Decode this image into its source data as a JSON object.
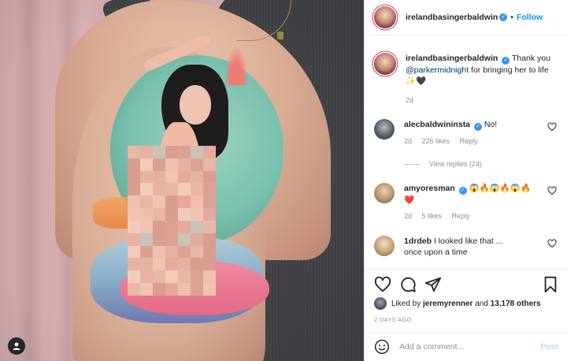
{
  "post": {
    "author": "irelandbasingerbaldwin",
    "follow_label": "Follow",
    "separator": "•"
  },
  "caption": {
    "author": "irelandbasingerbaldwin",
    "text_before": "Thank you",
    "mention": "@parkermidnight",
    "text_after": "for bringing her to life",
    "emoji": "✨🖤",
    "age": "2d"
  },
  "comments": [
    {
      "user": "alecbaldwininsta",
      "verified": true,
      "text": "No!",
      "age": "2d",
      "likes": "226 likes",
      "reply": "Reply",
      "view_replies": "View replies (24)"
    },
    {
      "user": "amyoresman",
      "verified": true,
      "text": "😱🔥😱🔥😱🔥",
      "text2": "❤️",
      "age": "2d",
      "likes": "5 likes",
      "reply": "Reply"
    },
    {
      "user": "1drdeb",
      "verified": false,
      "text": "I looked like that ...",
      "text2": "once upon a time"
    }
  ],
  "likes": {
    "prefix": "Liked by",
    "user": "jeremyrenner",
    "and": "and",
    "count": "13,178 others"
  },
  "date": "2 DAYS AGO",
  "add_comment": {
    "placeholder": "Add a comment...",
    "post_label": "Post"
  },
  "colors": {
    "link": "#00376b",
    "follow": "#0095f6",
    "verified": "#3897f0",
    "post_disabled": "#b2dffc",
    "muted": "#8e8e8e"
  }
}
